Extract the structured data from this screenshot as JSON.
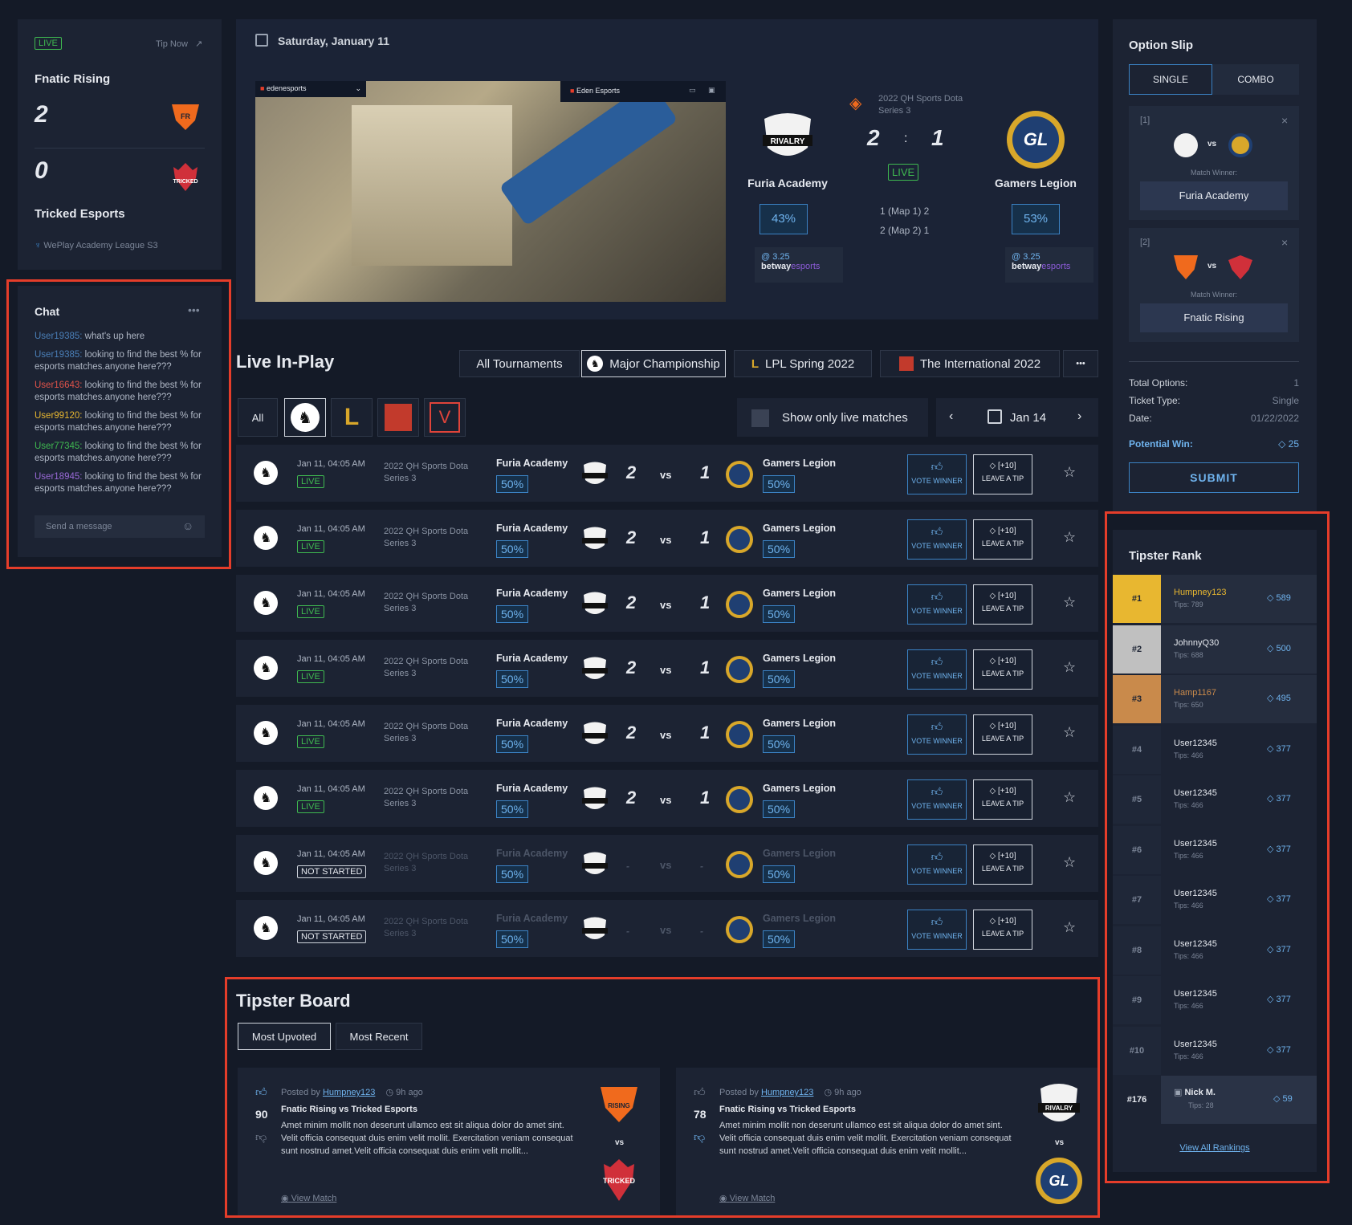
{
  "score_widget": {
    "live_label": "LIVE",
    "tip_now": "Tip Now",
    "team1": "Fnatic Rising",
    "score1": "2",
    "score2": "0",
    "team2": "Tricked Esports",
    "league": "WePlay Academy League S3"
  },
  "chat": {
    "title": "Chat",
    "messages": [
      {
        "user": "User19385:",
        "text": "what's up here",
        "color": "#4a7fb8"
      },
      {
        "user": "User19385:",
        "text": "looking to find the best % for esports matches.anyone here???",
        "color": "#4a7fb8"
      },
      {
        "user": "User16643:",
        "text": "looking to find the best % for esports matches.anyone here???",
        "color": "#e2534a"
      },
      {
        "user": "User99120:",
        "text": "looking to find the best % for esports matches.anyone here???",
        "color": "#e8b730"
      },
      {
        "user": "User77345:",
        "text": "looking to find the best % for esports matches.anyone here???",
        "color": "#3fb950"
      },
      {
        "user": "User18945:",
        "text": "looking to find the best % for esports matches.anyone here???",
        "color": "#9a6ad8"
      }
    ],
    "input_placeholder": "Send a message"
  },
  "featured": {
    "date": "Saturday, January 11",
    "stream_channel": "edenesports",
    "stream_name": "Eden Esports",
    "team1": "Furia Academy",
    "team2": "Gamers Legion",
    "series": "2022 QH Sports Dota Series 3",
    "score1": "2",
    "score2": "1",
    "score_sep": ":",
    "live": "LIVE",
    "map1": "1 (Map 1) 2",
    "map2": "2 (Map 2) 1",
    "pct1": "43%",
    "pct2": "53%",
    "odds1": "@ 3.25",
    "odds2": "@ 3.25",
    "bookmaker_a": "betway",
    "bookmaker_b": "esports",
    "logo1_text": "RIVALRY",
    "logo2_text": "GL"
  },
  "live_inplay": {
    "title": "Live In-Play",
    "tournament_tabs": [
      "All Tournaments",
      "Major Championship",
      "LPL Spring 2022",
      "The International 2022"
    ],
    "more": "•••",
    "all_filter": "All",
    "show_live_label": "Show only live matches",
    "date_nav": "Jan 14",
    "rows": [
      {
        "date": "Jan 11, 04:05 AM",
        "status": "LIVE",
        "series": "2022 QH Sports Dota Series 3",
        "team1": "Furia Academy",
        "team2": "Gamers Legion",
        "pct1": "50%",
        "pct2": "50%",
        "score1": "2",
        "score2": "1",
        "vs": "vs",
        "vote": "VOTE WINNER",
        "tip_bonus": "[+10]",
        "tip": "LEAVE A TIP",
        "dim": false
      },
      {
        "date": "Jan 11, 04:05 AM",
        "status": "LIVE",
        "series": "2022 QH Sports Dota Series 3",
        "team1": "Furia Academy",
        "team2": "Gamers Legion",
        "pct1": "50%",
        "pct2": "50%",
        "score1": "2",
        "score2": "1",
        "vs": "vs",
        "vote": "VOTE WINNER",
        "tip_bonus": "[+10]",
        "tip": "LEAVE A TIP",
        "dim": false
      },
      {
        "date": "Jan 11, 04:05 AM",
        "status": "LIVE",
        "series": "2022 QH Sports Dota Series 3",
        "team1": "Furia Academy",
        "team2": "Gamers Legion",
        "pct1": "50%",
        "pct2": "50%",
        "score1": "2",
        "score2": "1",
        "vs": "vs",
        "vote": "VOTE WINNER",
        "tip_bonus": "[+10]",
        "tip": "LEAVE A TIP",
        "dim": false
      },
      {
        "date": "Jan 11, 04:05 AM",
        "status": "LIVE",
        "series": "2022 QH Sports Dota Series 3",
        "team1": "Furia Academy",
        "team2": "Gamers Legion",
        "pct1": "50%",
        "pct2": "50%",
        "score1": "2",
        "score2": "1",
        "vs": "vs",
        "vote": "VOTE WINNER",
        "tip_bonus": "[+10]",
        "tip": "LEAVE A TIP",
        "dim": false
      },
      {
        "date": "Jan 11, 04:05 AM",
        "status": "LIVE",
        "series": "2022 QH Sports Dota Series 3",
        "team1": "Furia Academy",
        "team2": "Gamers Legion",
        "pct1": "50%",
        "pct2": "50%",
        "score1": "2",
        "score2": "1",
        "vs": "vs",
        "vote": "VOTE WINNER",
        "tip_bonus": "[+10]",
        "tip": "LEAVE A TIP",
        "dim": false
      },
      {
        "date": "Jan 11, 04:05 AM",
        "status": "LIVE",
        "series": "2022 QH Sports Dota Series 3",
        "team1": "Furia Academy",
        "team2": "Gamers Legion",
        "pct1": "50%",
        "pct2": "50%",
        "score1": "2",
        "score2": "1",
        "vs": "vs",
        "vote": "VOTE WINNER",
        "tip_bonus": "[+10]",
        "tip": "LEAVE A TIP",
        "dim": false
      },
      {
        "date": "Jan 11, 04:05 AM",
        "status": "NOT STARTED",
        "series": "2022 QH Sports Dota Series 3",
        "team1": "Furia Academy",
        "team2": "Gamers Legion",
        "pct1": "50%",
        "pct2": "50%",
        "score1": "-",
        "score2": "-",
        "vs": "vs",
        "vote": "VOTE WINNER",
        "tip_bonus": "[+10]",
        "tip": "LEAVE A TIP",
        "dim": true
      },
      {
        "date": "Jan 11, 04:05 AM",
        "status": "NOT STARTED",
        "series": "2022 QH Sports Dota Series 3",
        "team1": "Furia Academy",
        "team2": "Gamers Legion",
        "pct1": "50%",
        "pct2": "50%",
        "score1": "-",
        "score2": "-",
        "vs": "vs",
        "vote": "VOTE WINNER",
        "tip_bonus": "[+10]",
        "tip": "LEAVE A TIP",
        "dim": true
      }
    ]
  },
  "tipster_board": {
    "title": "Tipster Board",
    "tabs": [
      "Most Upvoted",
      "Most Recent"
    ],
    "posted_by": "Posted by",
    "view_match": "View Match",
    "vs": "vs",
    "cards": [
      {
        "votes": "90",
        "author": "Humpney123",
        "time": "9h ago",
        "title": "Fnatic Rising vs Tricked Esports",
        "body": "Amet minim mollit non deserunt ullamco est sit aliqua dolor do amet sint. Velit officia consequat duis enim velit mollit. Exercitation veniam consequat sunt nostrud amet.Velit officia consequat duis enim velit mollit...",
        "logo_top": "RISING",
        "logo_bottom": "TRICKED"
      },
      {
        "votes": "78",
        "author": "Humpney123",
        "time": "9h ago",
        "title": "Fnatic Rising vs Tricked Esports",
        "body": "Amet minim mollit non deserunt ullamco est sit aliqua dolor do amet sint. Velit officia consequat duis enim velit mollit. Exercitation veniam consequat sunt nostrud amet.Velit officia consequat duis enim velit mollit...",
        "logo_top": "RIVALRY",
        "logo_bottom": "GL"
      }
    ]
  },
  "option_slip": {
    "title": "Option Slip",
    "tabs": [
      "SINGLE",
      "COMBO"
    ],
    "bets": [
      {
        "index": "[1]",
        "vs": "vs",
        "label": "Match Winner:",
        "pick": "Furia Academy"
      },
      {
        "index": "[2]",
        "vs": "vs",
        "label": "Match Winner:",
        "pick": "Fnatic Rising"
      }
    ],
    "total_options_label": "Total Options:",
    "total_options": "1",
    "ticket_type_label": "Ticket Type:",
    "ticket_type": "Single",
    "date_label": "Date:",
    "date": "01/22/2022",
    "potential_win_label": "Potential Win:",
    "potential_win": "25",
    "submit": "SUBMIT"
  },
  "tipster_rank": {
    "title": "Tipster Rank",
    "rows": [
      {
        "rank": "#1",
        "name": "Humpney123",
        "tips": "Tips: 789",
        "points": "589",
        "color": "#e8b730"
      },
      {
        "rank": "#2",
        "name": "JohnnyQ30",
        "tips": "Tips: 688",
        "points": "500",
        "color": "#c0c0c0"
      },
      {
        "rank": "#3",
        "name": "Hamp1167",
        "tips": "Tips: 650",
        "points": "495",
        "color": "#c98a4b"
      },
      {
        "rank": "#4",
        "name": "User12345",
        "tips": "Tips: 466",
        "points": "377",
        "color": ""
      },
      {
        "rank": "#5",
        "name": "User12345",
        "tips": "Tips: 466",
        "points": "377",
        "color": ""
      },
      {
        "rank": "#6",
        "name": "User12345",
        "tips": "Tips: 466",
        "points": "377",
        "color": ""
      },
      {
        "rank": "#7",
        "name": "User12345",
        "tips": "Tips: 466",
        "points": "377",
        "color": ""
      },
      {
        "rank": "#8",
        "name": "User12345",
        "tips": "Tips: 466",
        "points": "377",
        "color": ""
      },
      {
        "rank": "#9",
        "name": "User12345",
        "tips": "Tips: 466",
        "points": "377",
        "color": ""
      },
      {
        "rank": "#10",
        "name": "User12345",
        "tips": "Tips: 466",
        "points": "377",
        "color": ""
      }
    ],
    "me": {
      "rank": "#176",
      "name": "Nick M.",
      "tips": "Tips: 28",
      "points": "59"
    },
    "view_all": "View All Rankings"
  },
  "colors": {
    "accent": "#3b82c4",
    "live": "#3fb950",
    "frame": "#e53d2a",
    "gold": "#e8b730"
  }
}
